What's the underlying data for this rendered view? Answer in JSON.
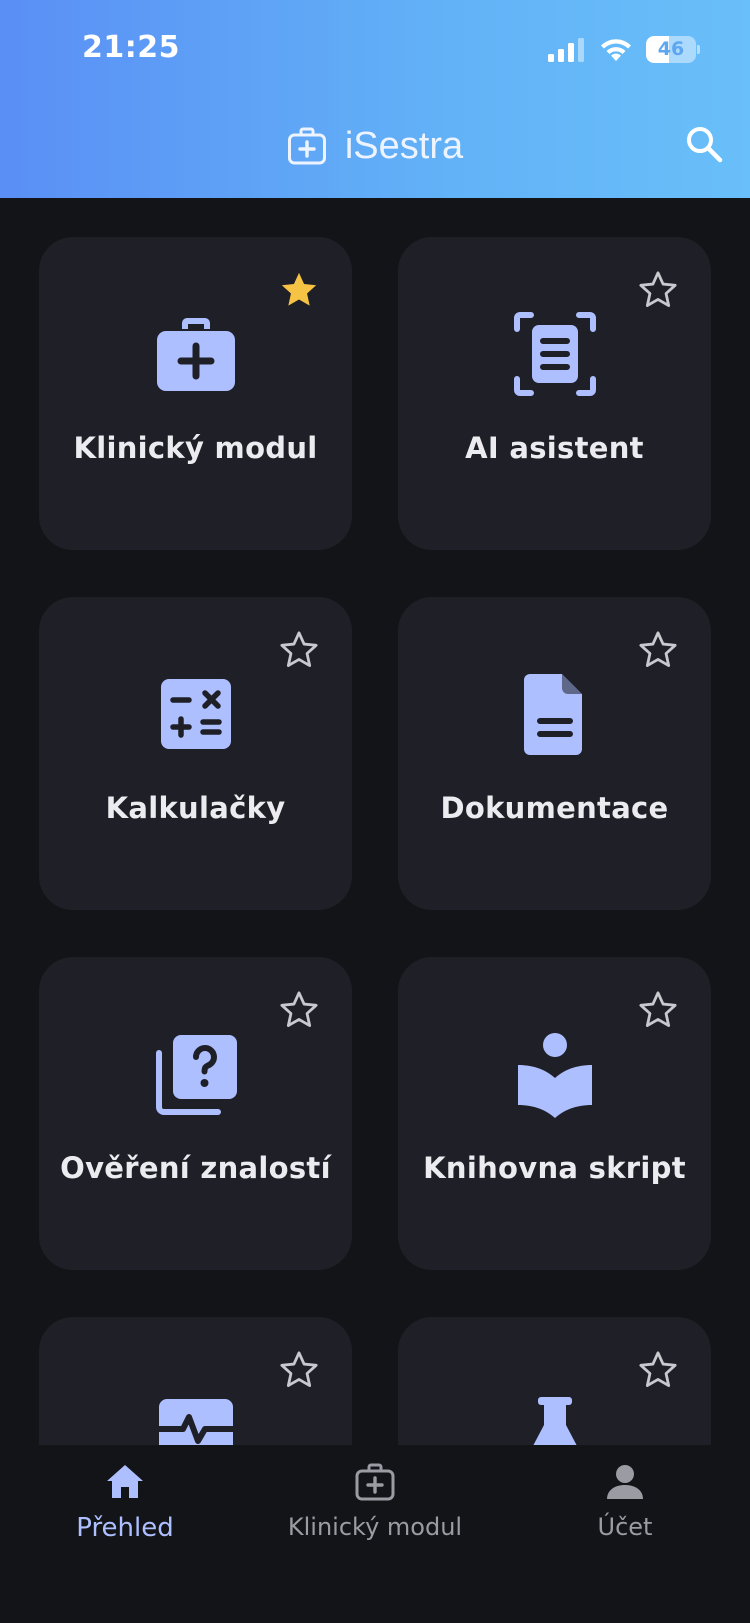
{
  "status_bar": {
    "time": "21:25",
    "battery_percent": "46",
    "battery_level": 0.46
  },
  "header": {
    "app_title": "iSestra",
    "title_icon": "medical-kit-icon",
    "search_icon": "search-icon"
  },
  "colors": {
    "accent": "#aebfff",
    "star_active": "#f6c344",
    "card_bg": "#1f2027",
    "page_bg": "#131418"
  },
  "tiles": [
    {
      "label": "Klinický modul",
      "icon": "medical-kit-icon",
      "favorite": true
    },
    {
      "label": "AI asistent",
      "icon": "document-scan-icon",
      "favorite": false
    },
    {
      "label": "Kalkulačky",
      "icon": "calculator-icon",
      "favorite": false
    },
    {
      "label": "Dokumentace",
      "icon": "document-icon",
      "favorite": false
    },
    {
      "label": "Ověření znalostí",
      "icon": "quiz-icon",
      "favorite": false
    },
    {
      "label": "Knihovna skript",
      "icon": "reading-icon",
      "favorite": false
    },
    {
      "label": "",
      "icon": "monitor-heart-icon",
      "favorite": false
    },
    {
      "label": "",
      "icon": "lab-flask-icon",
      "favorite": false
    }
  ],
  "tabbar": [
    {
      "label": "Přehled",
      "icon": "home-icon",
      "active": true
    },
    {
      "label": "Klinický modul",
      "icon": "medical-kit-icon",
      "active": false
    },
    {
      "label": "Účet",
      "icon": "person-icon",
      "active": false
    }
  ]
}
